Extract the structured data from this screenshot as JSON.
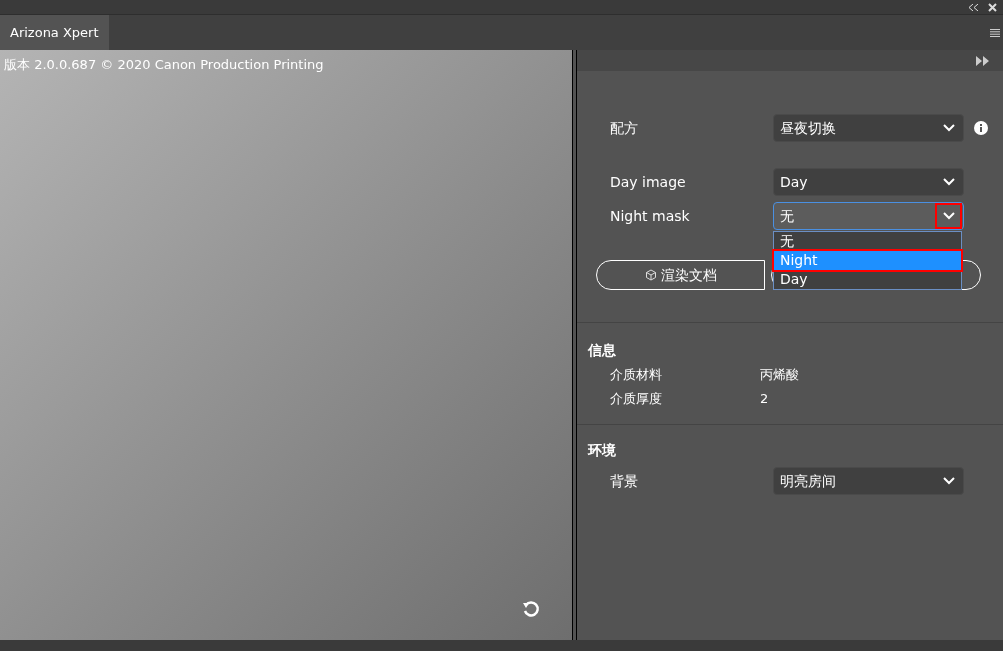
{
  "tab": {
    "label": "Arizona Xpert",
    "selected": true
  },
  "preview": {
    "caption": "版本 2.0.0.687 © 2020 Canon Production Printing"
  },
  "recipe": {
    "label": "配方",
    "value": "昼夜切换"
  },
  "day_image": {
    "label": "Day image",
    "value": "Day"
  },
  "night_mask": {
    "label": "Night mask",
    "value": "无",
    "expanded": true,
    "options": [
      {
        "label": "无",
        "highlighted": false
      },
      {
        "label": "Night",
        "highlighted": true
      },
      {
        "label": "Day",
        "highlighted": false
      }
    ]
  },
  "render_button": {
    "label": "渲染文档"
  },
  "info": {
    "title": "信息",
    "rows": [
      {
        "label": "介质材料",
        "value": "丙烯酸"
      },
      {
        "label": "介质厚度",
        "value": "2"
      }
    ]
  },
  "environment": {
    "title": "环境",
    "background": {
      "label": "背景",
      "value": "明亮房间"
    }
  }
}
